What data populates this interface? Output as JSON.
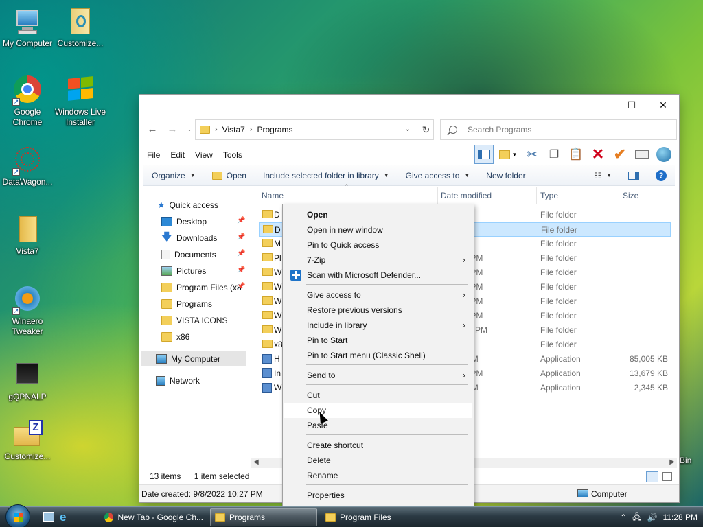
{
  "desktop": {
    "icons": [
      {
        "label": "My Computer"
      },
      {
        "label": "Customize..."
      },
      {
        "label": "Google Chrome"
      },
      {
        "label": "Windows Live Installer"
      },
      {
        "label": "DataWagon..."
      },
      {
        "label": "Vista7"
      },
      {
        "label": "Winaero Tweaker"
      },
      {
        "label": "gQPNALP"
      },
      {
        "label": "Customize..."
      },
      {
        "label": "Bin"
      }
    ]
  },
  "window": {
    "controls": {
      "minimize": "—",
      "maximize": "☐",
      "close": "✕"
    },
    "address": {
      "crumbs": [
        "Vista7",
        "Programs"
      ]
    },
    "search": {
      "placeholder": "Search Programs"
    },
    "menu": [
      "File",
      "Edit",
      "View",
      "Tools"
    ],
    "commands": {
      "organize": "Organize",
      "open": "Open",
      "include": "Include selected folder in library",
      "give_access": "Give access to",
      "new_folder": "New folder"
    },
    "nav": {
      "quick_access": "Quick access",
      "items": [
        "Desktop",
        "Downloads",
        "Documents",
        "Pictures",
        "Program Files (x8",
        "Programs",
        "VISTA ICONS",
        "x86"
      ],
      "my_computer": "My Computer",
      "network": "Network"
    },
    "columns": {
      "name": "Name",
      "date": "Date modified",
      "type": "Type",
      "size": "Size"
    },
    "rows": [
      {
        "name": "D",
        "date": "6:39 PM",
        "type": "File folder",
        "size": ""
      },
      {
        "name": "D",
        "date": "2:57 PM",
        "type": "File folder",
        "size": ""
      },
      {
        "name": "M",
        "date": "2:58 PM",
        "type": "File folder",
        "size": ""
      },
      {
        "name": "Pl",
        "date": "9 12:42 PM",
        "type": "File folder",
        "size": ""
      },
      {
        "name": "W",
        "date": "21 8:23 PM",
        "type": "File folder",
        "size": ""
      },
      {
        "name": "W",
        "date": "21 8:23 PM",
        "type": "File folder",
        "size": ""
      },
      {
        "name": "W",
        "date": "21 8:23 PM",
        "type": "File folder",
        "size": ""
      },
      {
        "name": "W",
        "date": "21 8:23 PM",
        "type": "File folder",
        "size": ""
      },
      {
        "name": "W",
        "date": "21 10:54 PM",
        "type": "File folder",
        "size": ""
      },
      {
        "name": "x8",
        "date": "2:48 PM",
        "type": "File folder",
        "size": ""
      },
      {
        "name": "H",
        "date": "4 4:12 PM",
        "type": "Application",
        "size": "85,005 KB"
      },
      {
        "name": "In",
        "date": "21 6:55 PM",
        "type": "Application",
        "size": "13,679 KB"
      },
      {
        "name": "W",
        "date": "3 8:15 PM",
        "type": "Application",
        "size": "2,345 KB"
      }
    ],
    "status": {
      "items": "13 items",
      "selected": "1 item selected"
    },
    "details": {
      "date_created": "Date created: 9/8/2022 10:27 PM",
      "location": "Computer"
    }
  },
  "context_menu": {
    "items": [
      {
        "label": "Open",
        "bold": true
      },
      {
        "label": "Open in new window"
      },
      {
        "label": "Pin to Quick access"
      },
      {
        "label": "7-Zip",
        "submenu": true
      },
      {
        "label": "Scan with Microsoft Defender..."
      },
      {
        "label": "Give access to",
        "submenu": true
      },
      {
        "label": "Restore previous versions"
      },
      {
        "label": "Include in library",
        "submenu": true
      },
      {
        "label": "Pin to Start"
      },
      {
        "label": "Pin to Start menu (Classic Shell)"
      },
      {
        "label": "Send to",
        "submenu": true
      },
      {
        "label": "Cut"
      },
      {
        "label": "Copy",
        "hovered": true
      },
      {
        "label": "Paste"
      },
      {
        "label": "Create shortcut"
      },
      {
        "label": "Delete"
      },
      {
        "label": "Rename"
      },
      {
        "label": "Properties"
      }
    ]
  },
  "taskbar": {
    "buttons": [
      "New Tab - Google Ch...",
      "Programs",
      "Program Files"
    ],
    "clock": "11:28 PM"
  }
}
